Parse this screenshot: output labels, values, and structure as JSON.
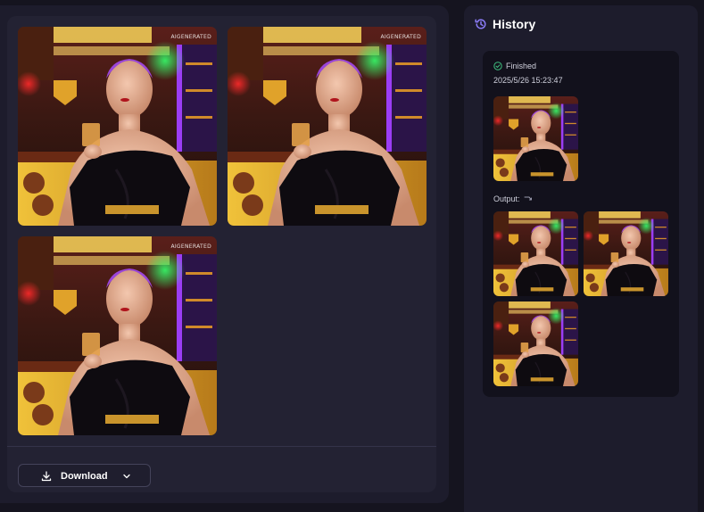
{
  "images": {
    "watermark": "AIGENERATED"
  },
  "toolbar": {
    "download_label": "Download"
  },
  "history": {
    "title": "History",
    "entry": {
      "status": "Finished",
      "timestamp": "2025/5/26 15:23:47",
      "output_label": "Output:"
    }
  },
  "colors": {
    "accent": "#7b6cf6",
    "success": "#3fbf7f",
    "background": "#15141f",
    "panel": "#1d1c2c"
  }
}
